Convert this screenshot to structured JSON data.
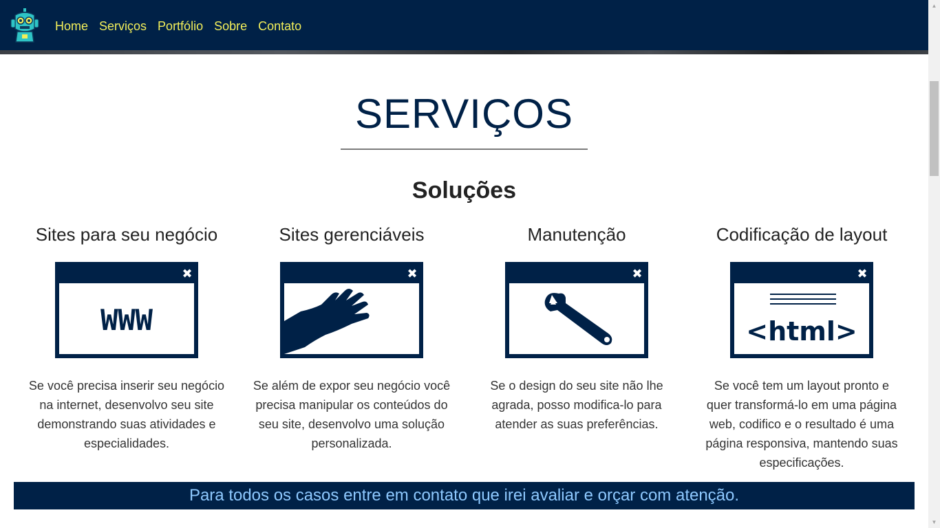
{
  "nav": {
    "items": [
      {
        "label": "Home"
      },
      {
        "label": "Serviços"
      },
      {
        "label": "Portfólio"
      },
      {
        "label": "Sobre"
      },
      {
        "label": "Contato"
      }
    ],
    "logo_icon": "robot-icon"
  },
  "section": {
    "title": "SERVIÇOS",
    "subtitle": "Soluções"
  },
  "services": [
    {
      "title": "Sites para seu negócio",
      "icon": "www-browser-icon",
      "icon_text": "WWW",
      "description": "Se você precisa inserir seu negócio na internet, desenvolvo seu site demonstrando suas atividades e especialidades."
    },
    {
      "title": "Sites gerenciáveis",
      "icon": "hand-browser-icon",
      "description": "Se além de expor seu negócio você precisa manipular os conteúdos do seu site, desenvolvo uma solução personalizada."
    },
    {
      "title": "Manutenção",
      "icon": "wrench-browser-icon",
      "description": "Se o design do seu site não lhe agrada, posso modifica-lo para atender as suas preferências."
    },
    {
      "title": "Codificação de layout",
      "icon": "html-browser-icon",
      "icon_text": "<html>",
      "description": "Se você tem um layout pronto e quer transformá-lo em uma página web, codifico e o resultado é uma página responsiva, mantendo suas especificações."
    }
  ],
  "banner": {
    "text": "Para todos os casos entre em contato que irei avaliar e orçar com atenção."
  },
  "colors": {
    "navy": "#002147",
    "nav_link": "#f3ef5a",
    "banner_text": "#8ec9ff",
    "logo_teal": "#2ec4c6"
  },
  "window_close_glyph": "✖"
}
